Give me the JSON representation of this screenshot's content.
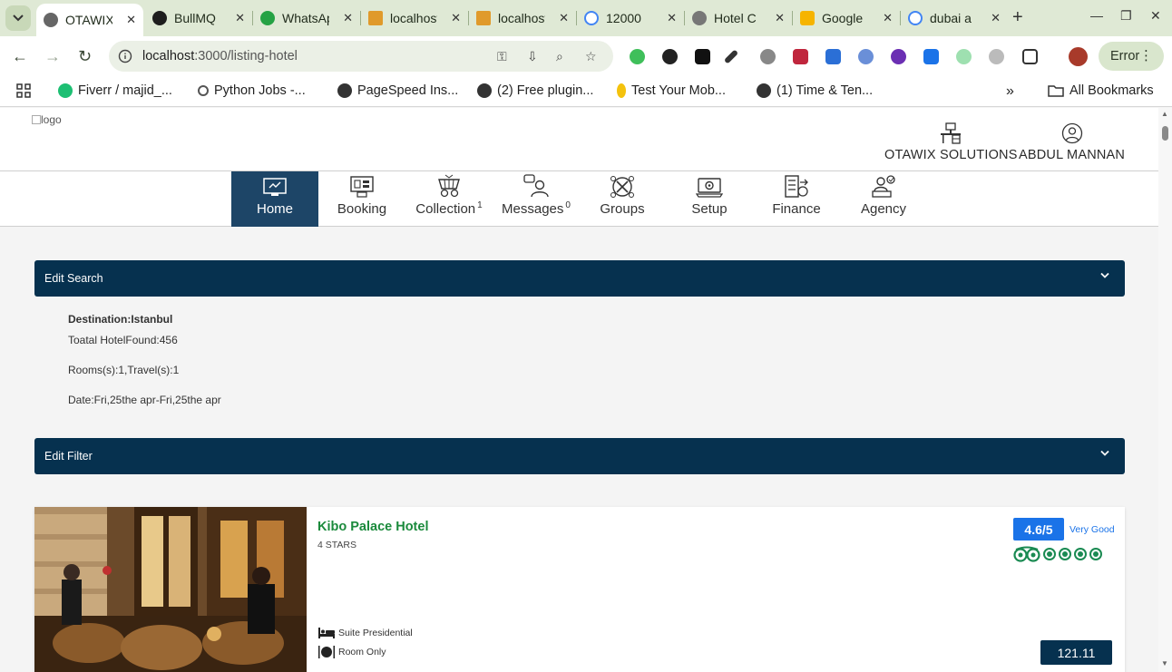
{
  "browser": {
    "tabs": [
      {
        "title": "OTAWIX",
        "favicon": "globe-icon",
        "active": true
      },
      {
        "title": "BullMQ",
        "favicon": "bullmq-icon",
        "active": false
      },
      {
        "title": "WhatsApp",
        "favicon": "whatsapp-icon",
        "active": false
      },
      {
        "title": "localhost",
        "favicon": "phpmyadmin-icon",
        "active": false
      },
      {
        "title": "localhost",
        "favicon": "phpmyadmin-icon",
        "active": false
      },
      {
        "title": "12000",
        "favicon": "google-icon",
        "active": false
      },
      {
        "title": "Hotel C",
        "favicon": "hotel-icon",
        "active": false
      },
      {
        "title": "Google",
        "favicon": "google-keep-icon",
        "active": false
      },
      {
        "title": "dubai a",
        "favicon": "google-icon",
        "active": false
      }
    ],
    "address": {
      "host": "localhost",
      "path": ":3000/listing-hotel"
    },
    "error_label": "Error",
    "bookmarks": [
      {
        "label": "Fiverr / majid_...",
        "icon": "fiverr-icon"
      },
      {
        "label": "Python Jobs -...",
        "icon": "info-icon"
      },
      {
        "label": "PageSpeed Ins...",
        "icon": "globe-icon"
      },
      {
        "label": "(2) Free plugin...",
        "icon": "globe-icon"
      },
      {
        "label": "Test Your Mob...",
        "icon": "bulb-icon"
      },
      {
        "label": "(1) Time & Ten...",
        "icon": "globe-icon"
      }
    ],
    "more_bookmarks": "»",
    "all_bookmarks": "All Bookmarks"
  },
  "header": {
    "logo_alt": "logo",
    "company": "OTAWIX SOLUTIONS",
    "user": "ABDUL MANNAN"
  },
  "nav": [
    {
      "label": "Home",
      "badge": "",
      "icon": "home-monitor-icon",
      "active": true
    },
    {
      "label": "Booking",
      "badge": "",
      "icon": "booking-icon",
      "active": false
    },
    {
      "label": "Collection",
      "badge": "1",
      "icon": "collection-icon",
      "active": false
    },
    {
      "label": "Messages",
      "badge": "0",
      "icon": "messages-icon",
      "active": false
    },
    {
      "label": "Groups",
      "badge": "",
      "icon": "groups-icon",
      "active": false
    },
    {
      "label": "Setup",
      "badge": "",
      "icon": "setup-icon",
      "active": false
    },
    {
      "label": "Finance",
      "badge": "",
      "icon": "finance-icon",
      "active": false
    },
    {
      "label": "Agency",
      "badge": "",
      "icon": "agency-icon",
      "active": false
    }
  ],
  "search_panel": {
    "title": "Edit Search",
    "destination": "Destination:Istanbul",
    "total": "Toatal HotelFound:456",
    "rooms": "Rooms(s):1,Travel(s):1",
    "date": "Date:Fri,25the apr-Fri,25the apr"
  },
  "filter_panel": {
    "title": "Edit Filter"
  },
  "hotel": {
    "name": "Kibo Palace Hotel",
    "stars": "4 STARS",
    "rating": "4.6/5",
    "rating_text": "Very Good",
    "tripadvisor_dots": 4,
    "room_type": "Suite Presidential",
    "board": "Room Only",
    "price": "121.11"
  },
  "colors": {
    "primary": "#06314f",
    "nav_active": "#1d4567",
    "hotel_name": "#1b8a3c",
    "rating": "#1a73e8",
    "tripadvisor": "#1a8a52"
  }
}
